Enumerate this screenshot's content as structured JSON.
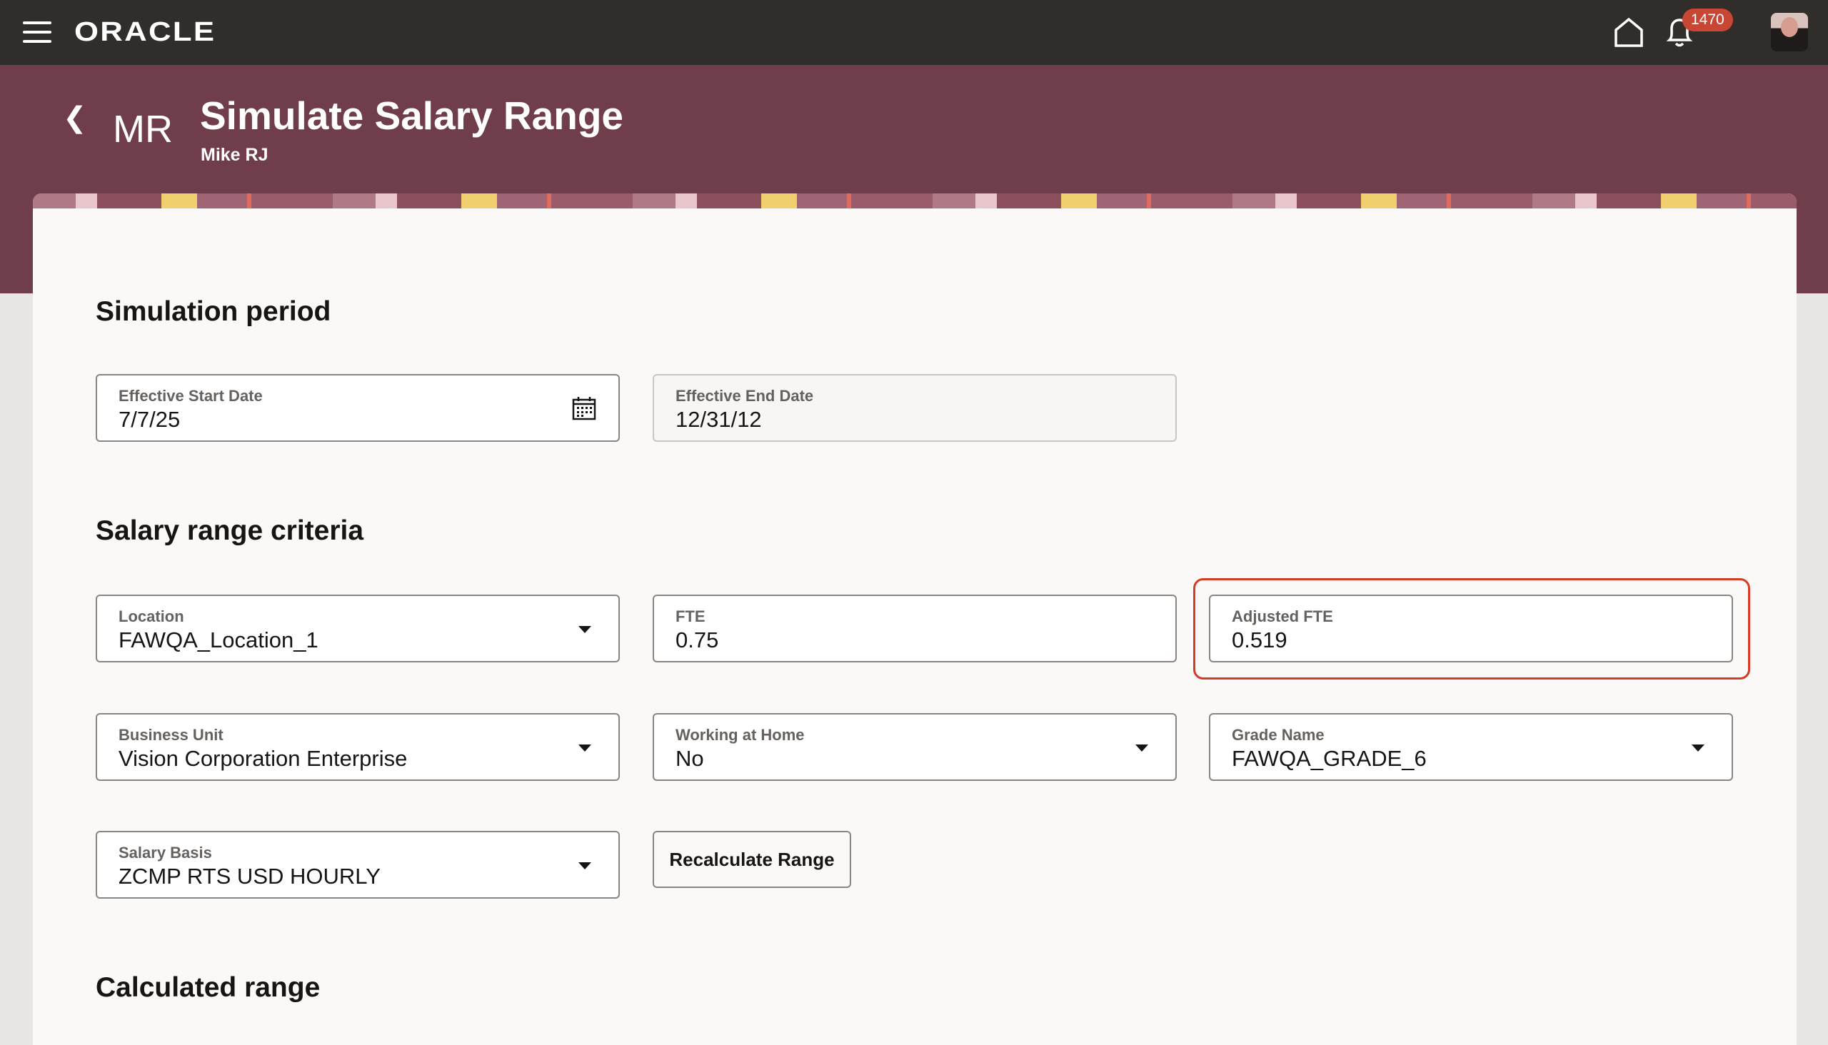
{
  "topbar": {
    "logo": "ORACLE",
    "notification_count": "1470"
  },
  "header": {
    "initials": "MR",
    "title": "Simulate Salary Range",
    "subtitle": "Mike RJ"
  },
  "sections": {
    "simulation_period": "Simulation period",
    "criteria": "Salary range criteria",
    "calculated": "Calculated range"
  },
  "fields": {
    "start_date": {
      "label": "Effective Start Date",
      "value": "7/7/25"
    },
    "end_date": {
      "label": "Effective End Date",
      "value": "12/31/12"
    },
    "location": {
      "label": "Location",
      "value": "FAWQA_Location_1"
    },
    "fte": {
      "label": "FTE",
      "value": "0.75"
    },
    "adjusted_fte": {
      "label": "Adjusted FTE",
      "value": "0.519"
    },
    "business_unit": {
      "label": "Business Unit",
      "value": "Vision Corporation Enterprise"
    },
    "working_at_home": {
      "label": "Working at Home",
      "value": "No"
    },
    "grade_name": {
      "label": "Grade Name",
      "value": "FAWQA_GRADE_6"
    },
    "salary_basis": {
      "label": "Salary Basis",
      "value": "ZCMP RTS USD HOURLY"
    }
  },
  "buttons": {
    "recalculate": "Recalculate Range"
  }
}
